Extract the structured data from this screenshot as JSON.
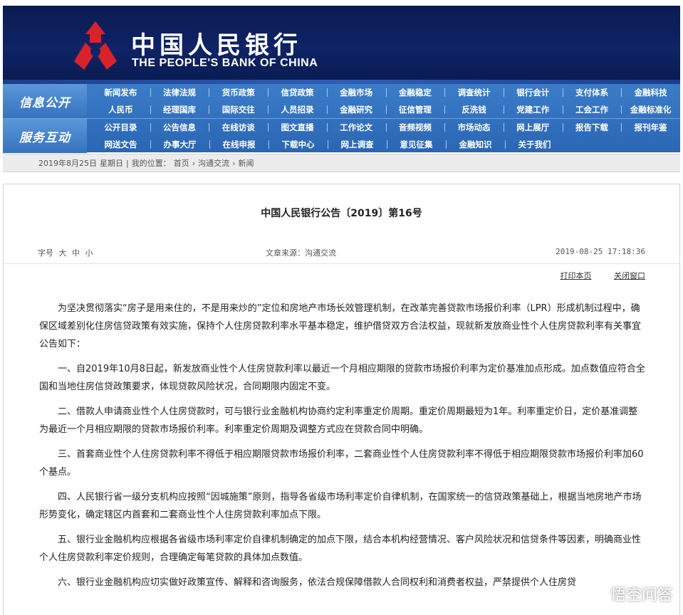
{
  "header": {
    "logo_cn": "中国人民银行",
    "logo_en": "THE PEOPLE'S BANK OF CHINA",
    "brand_color": "#0e2466",
    "emblem_color": "#d8232a"
  },
  "nav": {
    "groups": [
      {
        "title": "信息公开",
        "rows": [
          [
            "新闻发布",
            "法律法规",
            "货币政策",
            "信贷政策",
            "金融市场",
            "金融稳定",
            "调查统计",
            "银行会计",
            "支付体系",
            "金融科技"
          ],
          [
            "人民币",
            "经理国库",
            "国际交往",
            "人员招录",
            "金融研究",
            "征信管理",
            "反洗钱",
            "党建工作",
            "工会工作",
            "金融标准化"
          ]
        ]
      },
      {
        "title": "服务互动",
        "rows": [
          [
            "公开目录",
            "公告信息",
            "在线访谈",
            "图文直播",
            "工作论文",
            "音频视频",
            "市场动态",
            "网上展厅",
            "报告下载",
            "报刊年鉴"
          ],
          [
            "网送文告",
            "办事大厅",
            "在线申报",
            "下载中心",
            "网上调查",
            "意见征集",
            "金融知识",
            "关于我们",
            "",
            ""
          ]
        ]
      }
    ]
  },
  "breadcrumb": {
    "date": "2019年8月25日",
    "weekday": "星期日",
    "sep": "|",
    "location_label": "我的位置：",
    "items": [
      "首页",
      "沟通交流",
      "新闻"
    ]
  },
  "article": {
    "title": "中国人民银行公告〔2019〕第16号",
    "fontsize_label": "字号",
    "fontsize_options": [
      "大",
      "中",
      "小"
    ],
    "source": "文章来源：沟通交流",
    "timestamp": "2019-08-25 17:18:36",
    "print_label": "打印本页",
    "close_label": "关闭窗口",
    "paragraphs": [
      "为坚决贯彻落实“房子是用来住的，不是用来炒的”定位和房地产市场长效管理机制，在改革完善贷款市场报价利率（LPR）形成机制过程中，确保区域差别化住房信贷政策有效实施，保持个人住房贷款利率水平基本稳定，维护借贷双方合法权益，现就新发放商业性个人住房贷款利率有关事宜公告如下：",
      "一、自2019年10月8日起，新发放商业性个人住房贷款利率以最近一个月相应期限的贷款市场报价利率为定价基准加点形成。加点数值应符合全国和当地住房信贷政策要求，体现贷款风险状况，合同期限内固定不变。",
      "二、借款人申请商业性个人住房贷款时，可与银行业金融机构协商约定利率重定价周期。重定价周期最短为1年。利率重定价日，定价基准调整为最近一个月相应期限的贷款市场报价利率。利率重定价周期及调整方式应在贷款合同中明确。",
      "三、首套商业性个人住房贷款利率不得低于相应期限贷款市场报价利率，二套商业性个人住房贷款利率不得低于相应期限贷款市场报价利率加60个基点。",
      "四、人民银行省一级分支机构应按照“因城施策”原则，指导各省级市场利率定价自律机制，在国家统一的信贷政策基础上，根据当地房地产市场形势变化，确定辖区内首套和二套商业性个人住房贷款利率加点下限。",
      "五、银行业金融机构应根据各省级市场利率定价自律机制确定的加点下限，结合本机构经营情况、客户风险状况和信贷条件等因素，明确商业性个人住房贷款利率定价规则，合理确定每笔贷款的具体加点数值。",
      "六、银行业金融机构应切实做好政策宣传、解释和咨询服务，依法合规保障借款人合同权利和消费者权益，严禁提供个人住房贷"
    ]
  },
  "watermark": {
    "text": "悟空问答",
    "icon": "wukong-icon"
  }
}
